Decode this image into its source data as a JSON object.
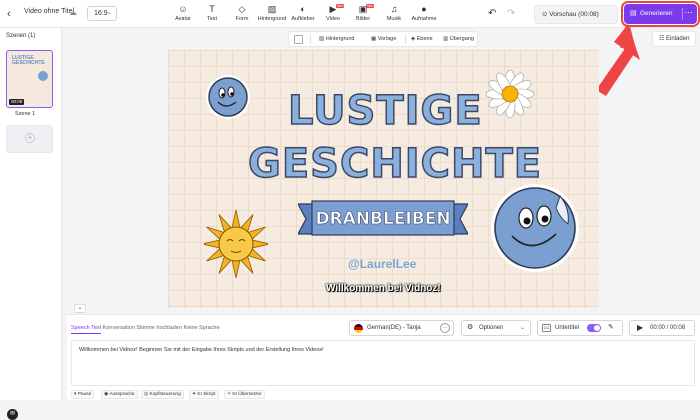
{
  "header": {
    "title": "Video ohne Titel",
    "aspect_ratio": "16:9",
    "tools": [
      {
        "label": "Avatar",
        "icon": "avatar-icon",
        "badge": ""
      },
      {
        "label": "Text",
        "icon": "text-icon",
        "badge": ""
      },
      {
        "label": "Form",
        "icon": "shape-icon",
        "badge": ""
      },
      {
        "label": "Hintergrund",
        "icon": "background-icon",
        "badge": ""
      },
      {
        "label": "Aufkleber",
        "icon": "sticker-icon",
        "badge": ""
      },
      {
        "label": "Video",
        "icon": "video-icon",
        "badge": "Neu"
      },
      {
        "label": "Bilder",
        "icon": "image-icon",
        "badge": "Neu"
      },
      {
        "label": "Musik",
        "icon": "music-icon",
        "badge": ""
      },
      {
        "label": "Aufnahme",
        "icon": "record-icon",
        "badge": ""
      }
    ],
    "preview_label": "Vorschau (00:08)",
    "generate_label": "Generieren",
    "accent_color": "#7c3aed",
    "highlight_color": "#ef4444"
  },
  "sidebar": {
    "title": "Szenen (1)",
    "scene_label": "Szene 1",
    "scene_duration": "00:08",
    "thumb_text": "LUSTIGE GESCHICHTE"
  },
  "context_toolbar": {
    "items": [
      "Hintergrund",
      "Vorlage",
      "Ebene",
      "Übergang"
    ]
  },
  "invite_label": "Einladen",
  "canvas": {
    "title_line1": "LUSTIGE",
    "title_line2": "GESCHICHTE",
    "banner": "DRANBLEIBEN",
    "handle": "@LaurelLee",
    "subtitle": "Willkommen bei Vidnoz!",
    "background_color": "#f6ebe0",
    "title_color": "#8cb0dc"
  },
  "bottom": {
    "tabs": [
      "Speech Text",
      "Konversation",
      "Stimme hochladen",
      "Keine Sprache"
    ],
    "voice": "German(DE) - Tanja",
    "options_label": "Optionen",
    "subtitle_label": "Untertitel",
    "subtitle_enabled": true,
    "time": "00:00 / 00:08",
    "script": "Willkommen bei Vidnoz! Beginnen Sie mit der Eingabe Ihres Skripts und der Erstellung Ihres Videos!",
    "chips": [
      "Pause",
      "Aussprache",
      "Kopfsteuerung",
      "KI Skript",
      "KI Übersetzer"
    ]
  }
}
